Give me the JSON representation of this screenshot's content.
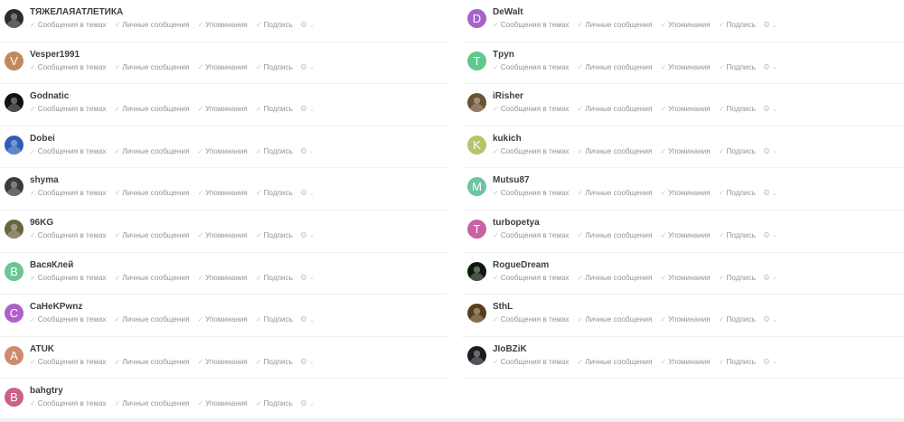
{
  "option_labels": {
    "topics": "Сообщения в темах",
    "messages": "Личные сообщения",
    "mentions": "Упоминания",
    "subscription": "Подпись"
  },
  "icons": {
    "check": "check-icon",
    "gear": "gear-icon",
    "chevron": "chevron-down-icon"
  },
  "left_users": [
    {
      "name": "ТЯЖЕЛАЯАТЛЕТИКА",
      "avatar_type": "image",
      "avatar_bg": "#2b2b2b"
    },
    {
      "name": "Vesper1991",
      "avatar_type": "letter",
      "letter": "V",
      "avatar_bg": "#c08a5e"
    },
    {
      "name": "Godnatic",
      "avatar_type": "image",
      "avatar_bg": "#111111"
    },
    {
      "name": "Dobei",
      "avatar_type": "image",
      "avatar_bg": "#2e5fb7"
    },
    {
      "name": "shyma",
      "avatar_type": "image",
      "avatar_bg": "#3a3a3a"
    },
    {
      "name": "96KG",
      "avatar_type": "image",
      "avatar_bg": "#6b6440"
    },
    {
      "name": "ВасяКлей",
      "avatar_type": "letter",
      "letter": "В",
      "avatar_bg": "#6cc596"
    },
    {
      "name": "CaHeKPwnz",
      "avatar_type": "letter",
      "letter": "C",
      "avatar_bg": "#b061c9"
    },
    {
      "name": "ATUK",
      "avatar_type": "letter",
      "letter": "A",
      "avatar_bg": "#cf8a6e"
    },
    {
      "name": "bahgtry",
      "avatar_type": "letter",
      "letter": "B",
      "avatar_bg": "#c9618a"
    }
  ],
  "right_users": [
    {
      "name": "DeWalt",
      "avatar_type": "letter",
      "letter": "D",
      "avatar_bg": "#a861c9"
    },
    {
      "name": "Tpyn",
      "avatar_type": "letter",
      "letter": "T",
      "avatar_bg": "#5fc98c"
    },
    {
      "name": "iRisher",
      "avatar_type": "image",
      "avatar_bg": "#6a5232"
    },
    {
      "name": "kukich",
      "avatar_type": "letter",
      "letter": "K",
      "avatar_bg": "#b5c56a"
    },
    {
      "name": "Mutsu87",
      "avatar_type": "letter",
      "letter": "M",
      "avatar_bg": "#6cc5a0"
    },
    {
      "name": "turbopetya",
      "avatar_type": "letter",
      "letter": "T",
      "avatar_bg": "#c961a6"
    },
    {
      "name": "RogueDream",
      "avatar_type": "image",
      "avatar_bg": "#0c1a0c"
    },
    {
      "name": "SthL",
      "avatar_type": "image",
      "avatar_bg": "#5a3d1a"
    },
    {
      "name": "JIoBZiK",
      "avatar_type": "image",
      "avatar_bg": "#1c1c22"
    }
  ]
}
